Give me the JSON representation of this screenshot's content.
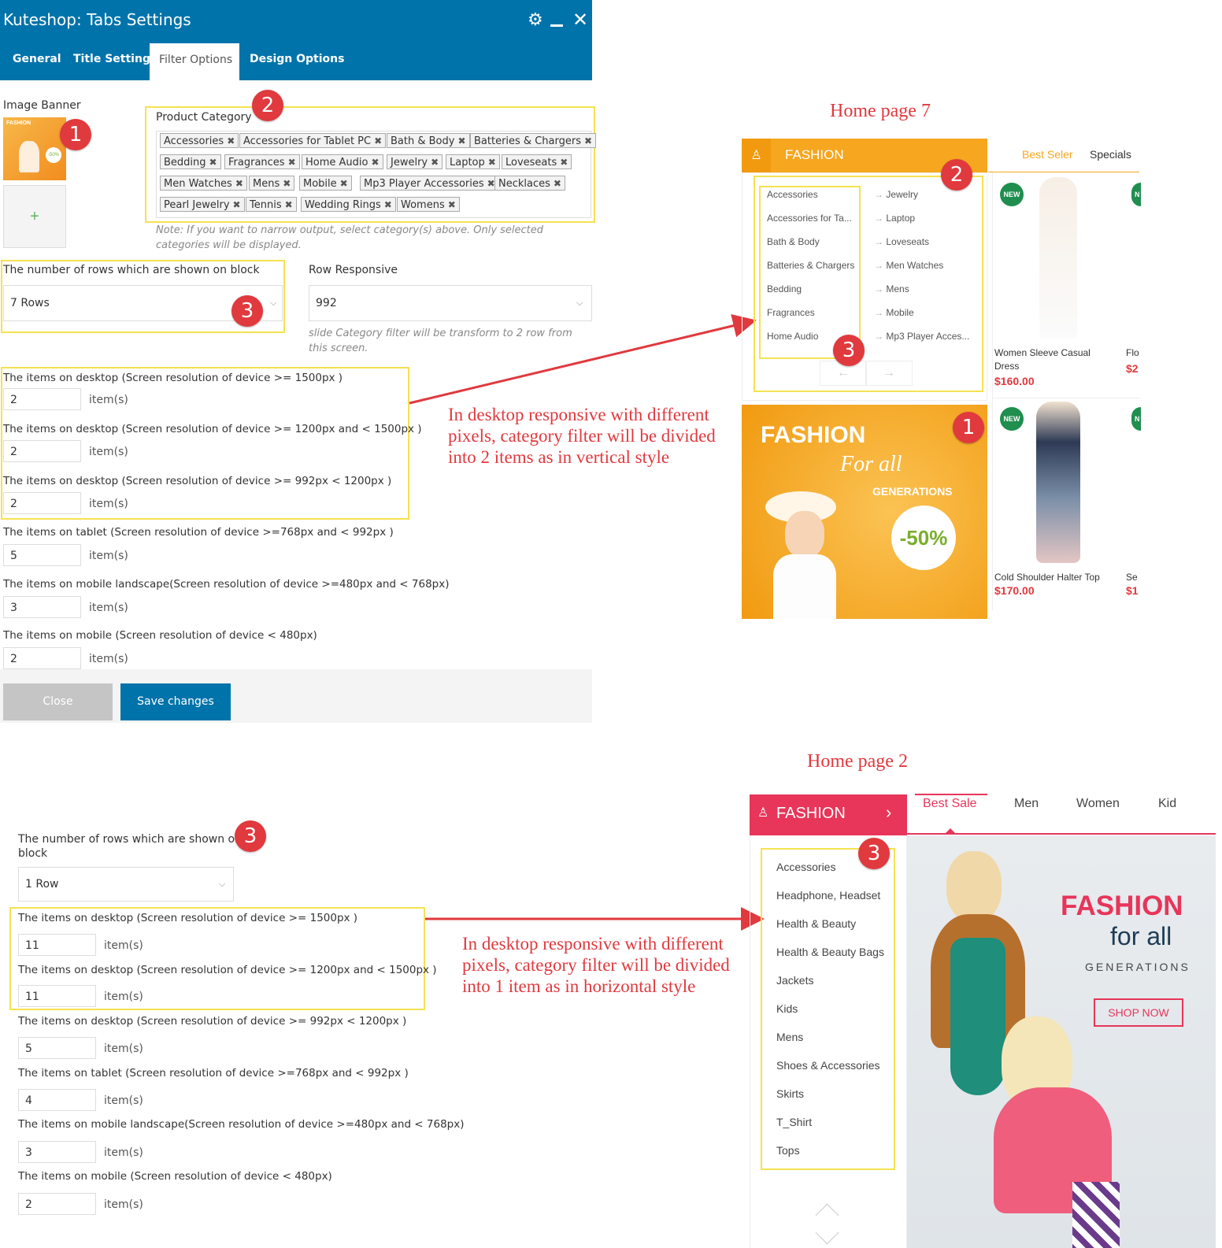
{
  "modal": {
    "title": "Kuteshop: Tabs Settings",
    "tabs": [
      "General",
      "Title Settings",
      "Filter Options",
      "Design Options"
    ],
    "active_tab": "Filter Options"
  },
  "image_banner": {
    "label": "Image Banner",
    "add_symbol": "+"
  },
  "product_category": {
    "label": "Product Category",
    "tags": [
      "Accessories",
      "Accessories for Tablet PC",
      "Bath & Body",
      "Batteries & Chargers",
      "Bedding",
      "Fragrances",
      "Home Audio",
      "Jewelry",
      "Laptop",
      "Loveseats",
      "Men Watches",
      "Mens",
      "Mobile",
      "Mp3 Player Accessories",
      "Necklaces",
      "Pearl Jewelry",
      "Tennis",
      "Wedding Rings",
      "Womens"
    ],
    "note": "Note: If you want to narrow output, select category(s) above. Only selected categories will be displayed."
  },
  "rows": {
    "label": "The number of rows which are shown on block",
    "value": "7 Rows"
  },
  "row_responsive": {
    "label": "Row Responsive",
    "value": "992",
    "note": "slide Category filter will be transform to 2 row from this screen."
  },
  "unit": "item(s)",
  "items_settings": [
    {
      "label": "The items on desktop (Screen resolution of device >= 1500px )",
      "value": "2"
    },
    {
      "label": "The items on desktop (Screen resolution of device >= 1200px and < 1500px )",
      "value": "2"
    },
    {
      "label": "The items on desktop (Screen resolution of device >= 992px < 1200px )",
      "value": "2"
    },
    {
      "label": "The items on tablet (Screen resolution of device >=768px and < 992px )",
      "value": "5"
    },
    {
      "label": "The items on mobile landscape(Screen resolution of device >=480px and < 768px)",
      "value": "3"
    },
    {
      "label": "The items on mobile (Screen resolution of device < 480px)",
      "value": "2"
    }
  ],
  "footer": {
    "close": "Close",
    "save": "Save changes"
  },
  "badges": [
    "1",
    "2",
    "3"
  ],
  "annotation_1": "In desktop responsive with different pixels, category filter will be divided into 2 items as in vertical style",
  "annotation_2": "In desktop responsive with different pixels, category filter will be divided into 1 item as in horizontal style",
  "home7": {
    "title": "Home page 7",
    "category": "FASHION",
    "tabs": [
      "Best Seler",
      "Specials"
    ],
    "col1": [
      "Accessories",
      "Accessories for Ta...",
      "Bath & Body",
      "Batteries & Chargers",
      "Bedding",
      "Fragrances",
      "Home Audio"
    ],
    "col2": [
      "Jewelry",
      "Laptop",
      "Loveseats",
      "Men Watches",
      "Mens",
      "Mobile",
      "Mp3 Player Acces..."
    ],
    "new_label": "NEW",
    "new_label_cut": "N",
    "banner": {
      "title": "FASHION",
      "script": "For all",
      "sub": "GENERATIONS",
      "discount": "-50%"
    },
    "products": [
      {
        "name_1": "Women Sleeve Casual",
        "name_2": "Dress",
        "price": "$160.00"
      },
      {
        "name": "Cold Shoulder Halter Top",
        "price": "$170.00"
      }
    ],
    "cut_names": [
      "Flo",
      "Se"
    ],
    "cut_prices": [
      "$2",
      "$1"
    ]
  },
  "lower": {
    "rows_label_1": "The number of rows which are shown on",
    "rows_label_2": "block",
    "rows_value": "1 Row",
    "items_settings": [
      {
        "label": "The items on desktop (Screen resolution of device >= 1500px )",
        "value": "11"
      },
      {
        "label": "The items on desktop (Screen resolution of device >= 1200px and < 1500px )",
        "value": "11"
      },
      {
        "label": "The items on desktop (Screen resolution of device >= 992px < 1200px )",
        "value": "5"
      },
      {
        "label": "The items on tablet (Screen resolution of device >=768px and < 992px )",
        "value": "4"
      },
      {
        "label": "The items on mobile landscape(Screen resolution of device >=480px and < 768px)",
        "value": "3"
      },
      {
        "label": "The items on mobile (Screen resolution of device < 480px)",
        "value": "2"
      }
    ]
  },
  "home2": {
    "title": "Home page 2",
    "category": "FASHION",
    "tabs": [
      "Best Sale",
      "Men",
      "Women",
      "Kid"
    ],
    "categories": [
      "Accessories",
      "Headphone, Headset",
      "Health & Beauty",
      "Health & Beauty Bags",
      "Jackets",
      "Kids",
      "Mens",
      "Shoes & Accessories",
      "Skirts",
      "T_Shirt",
      "Tops"
    ],
    "banner": {
      "title": "FASHION",
      "sub_1": "for all",
      "sub_2": "GENERATIONS",
      "button": "SHOP NOW"
    }
  },
  "colors": {
    "wp_blue": "#0073aa",
    "annotation_red": "#e0393e",
    "highlight_yellow": "#f5e251",
    "hp7_orange": "#f6a61f",
    "hp2_pink": "#e8355a"
  }
}
